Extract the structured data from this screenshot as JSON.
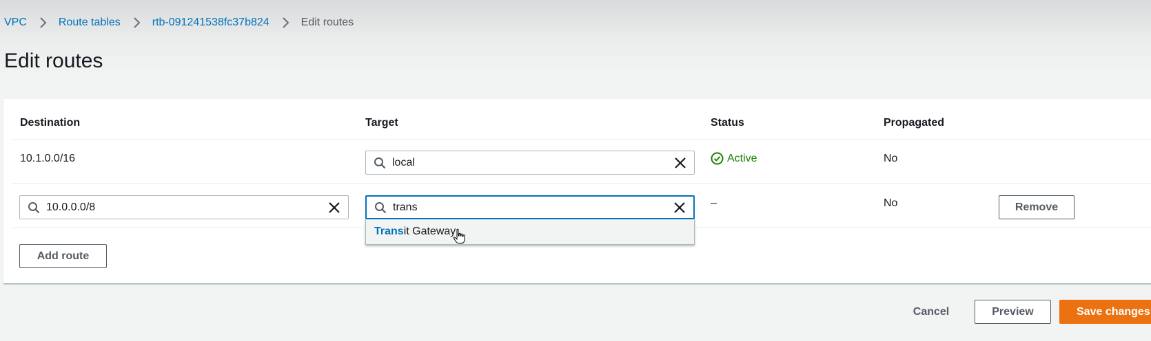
{
  "breadcrumb": {
    "items": [
      "VPC",
      "Route tables",
      "rtb-091241538fc37b824"
    ],
    "current": "Edit routes"
  },
  "page_title": "Edit routes",
  "table": {
    "headers": {
      "destination": "Destination",
      "target": "Target",
      "status": "Status",
      "propagated": "Propagated"
    },
    "rows": [
      {
        "destination": "10.1.0.0/16",
        "target": "local",
        "status": "Active",
        "propagated": "No"
      },
      {
        "destination": "10.0.0.0/8",
        "target": "trans",
        "status": "–",
        "propagated": "No",
        "remove_label": "Remove"
      }
    ]
  },
  "dropdown": {
    "match": "Trans",
    "rest": "it Gateway"
  },
  "add_route_label": "Add route",
  "footer": {
    "cancel_label": "Cancel",
    "preview_label": "Preview",
    "save_label": "Save changes"
  },
  "colors": {
    "link": "#0073bb",
    "active": "#1d8102",
    "primary": "#ec7211",
    "focus": "#0073bb"
  }
}
